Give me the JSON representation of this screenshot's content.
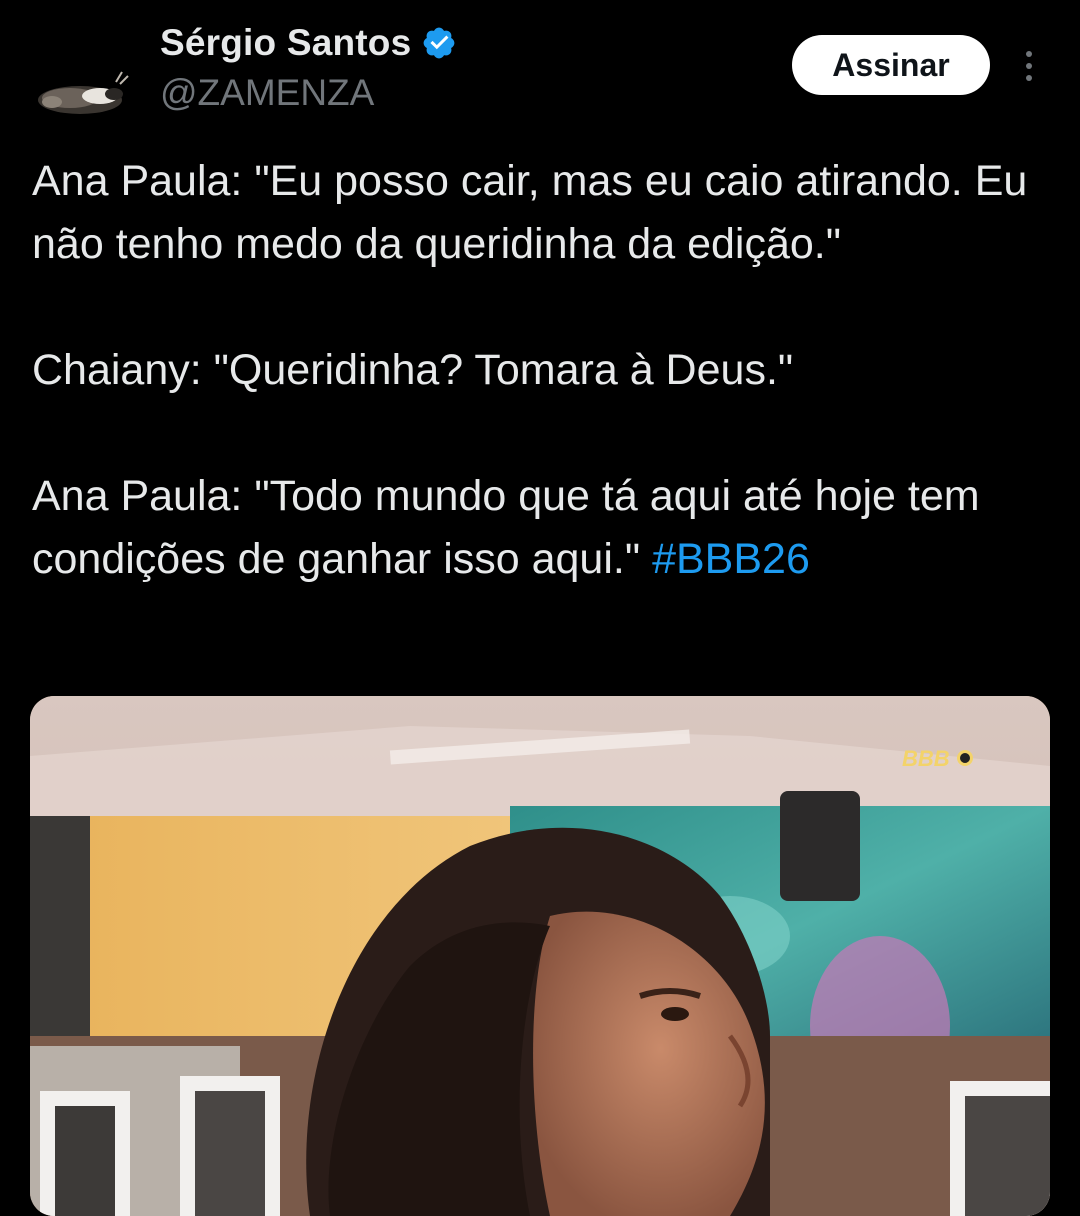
{
  "author": {
    "display_name": "Sérgio Santos",
    "handle": "@ZAMENZA",
    "verified": true,
    "avatar_icon": "dog-avatar-icon"
  },
  "actions": {
    "subscribe_label": "Assinar",
    "more_icon": "more-options-icon"
  },
  "tweet": {
    "paragraphs": [
      "Ana Paula: \"Eu posso cair, mas eu caio atirando. Eu não tenho medo da queridinha da edição.\"",
      "Chaiany: \"Queridinha? Tomara à Deus.\"",
      "Ana Paula: \"Todo mundo que tá aqui até hoje tem condições de ganhar isso aqui.\""
    ],
    "hashtag": "#BBB26"
  },
  "media": {
    "watermark": "BBB",
    "description_icon": "video-still-image"
  },
  "colors": {
    "background": "#000000",
    "text": "#e7e9ea",
    "secondary_text": "#71767b",
    "link": "#1d9bf0",
    "verified_badge": "#1d9bf0"
  }
}
